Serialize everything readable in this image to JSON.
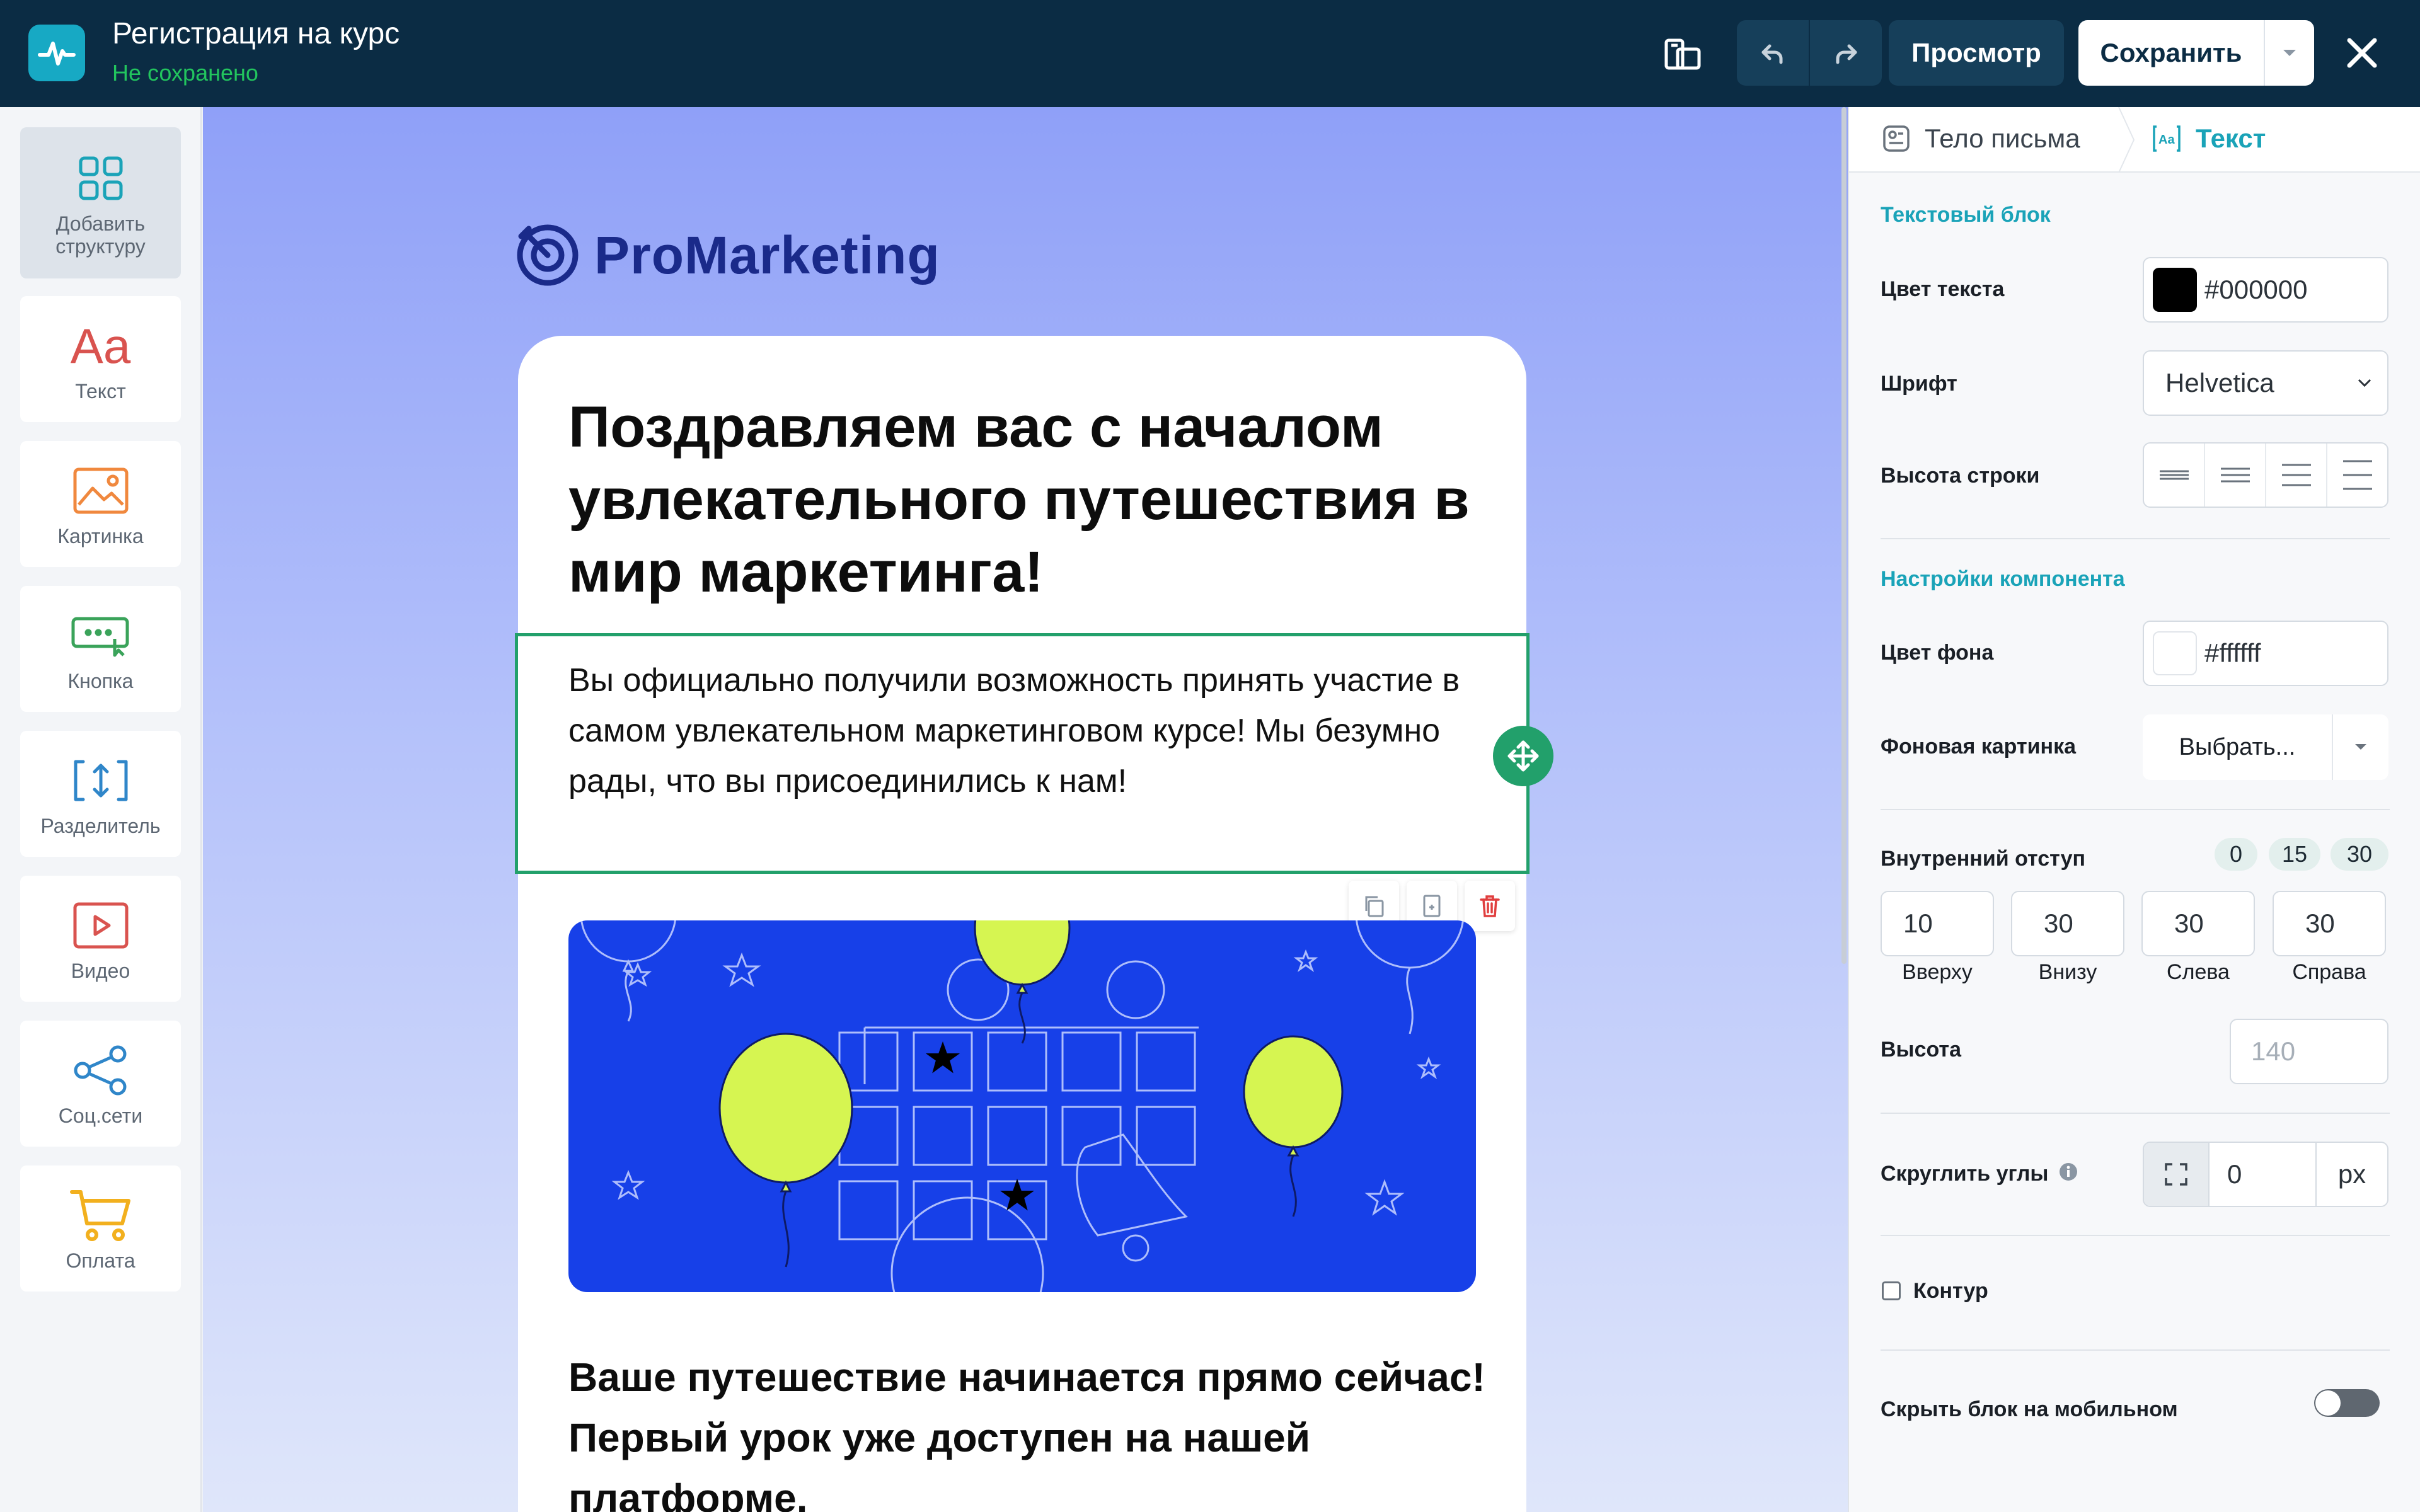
{
  "header": {
    "title": "Регистрация на курс",
    "status": "Не сохранено",
    "preview_label": "Просмотр",
    "save_label": "Сохранить"
  },
  "sidebar": {
    "items": [
      {
        "label": "Добавить структуру",
        "icon": "grid-icon"
      },
      {
        "label": "Текст",
        "icon": "text-aa-icon"
      },
      {
        "label": "Картинка",
        "icon": "image-icon"
      },
      {
        "label": "Кнопка",
        "icon": "button-icon"
      },
      {
        "label": "Разделитель",
        "icon": "divider-icon"
      },
      {
        "label": "Видео",
        "icon": "video-icon"
      },
      {
        "label": "Соц.сети",
        "icon": "share-icon"
      },
      {
        "label": "Оплата",
        "icon": "cart-icon"
      }
    ]
  },
  "canvas": {
    "brand": "ProMarketing",
    "headline": "Поздравляем вас с началом увлекательного путешествия в мир маркетинга!",
    "body": "Вы официально получили возможность принять участие в самом увлекательном маркетинговом курсе! Мы безумно рады, что вы присоединились к нам!",
    "subhead": "Ваше путешествие начинается прямо сейчас! Первый урок уже доступен на нашей платформе."
  },
  "panel": {
    "breadcrumb_body": "Тело письма",
    "breadcrumb_text": "Текст",
    "text_block_title": "Текстовый блок",
    "text_color_label": "Цвет текста",
    "text_color_value": "#000000",
    "font_label": "Шрифт",
    "font_value": "Helvetica",
    "line_height_label": "Высота строки",
    "component_title": "Настройки компонента",
    "bg_color_label": "Цвет фона",
    "bg_color_value": "#ffffff",
    "bg_image_label": "Фоновая картинка",
    "bg_image_button": "Выбрать...",
    "padding_label": "Внутренний отступ",
    "padding_presets": [
      "0",
      "15",
      "30"
    ],
    "padding": [
      {
        "value": "10",
        "caption": "Вверху"
      },
      {
        "value": "30",
        "caption": "Внизу"
      },
      {
        "value": "30",
        "caption": "Слева"
      },
      {
        "value": "30",
        "caption": "Справа"
      }
    ],
    "height_label": "Высота",
    "height_placeholder": "140",
    "radius_label": "Скруглить углы",
    "radius_value": "0",
    "radius_unit": "px",
    "outline_label": "Контур",
    "outline_checked": false,
    "hide_mobile_label": "Скрыть блок на мобильном",
    "hide_mobile_on": false
  },
  "colors": {
    "topbar": "#0b2c44",
    "accent": "#1aa3b8",
    "selection": "#22a06b",
    "brand": "#1a2a8a",
    "illustration_bg": "#1740e8",
    "balloon": "#d6f551"
  }
}
